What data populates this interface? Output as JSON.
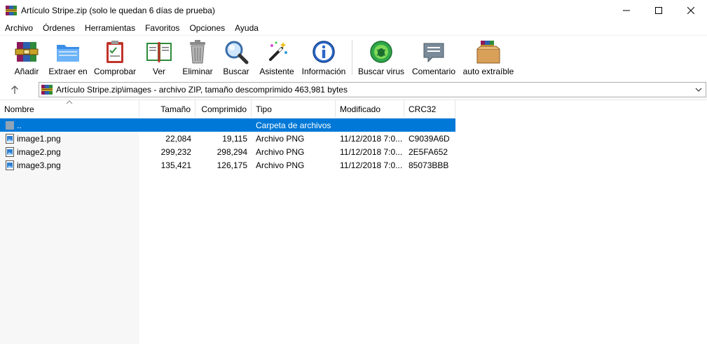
{
  "window": {
    "title": "Artículo Stripe.zip (solo le quedan 6 días de prueba)",
    "icon": "winrar-books-icon"
  },
  "menu": [
    "Archivo",
    "Órdenes",
    "Herramientas",
    "Favoritos",
    "Opciones",
    "Ayuda"
  ],
  "toolbar": [
    {
      "label": "Añadir",
      "icon": "add-archive-icon"
    },
    {
      "label": "Extraer en",
      "icon": "extract-folder-icon"
    },
    {
      "label": "Comprobar",
      "icon": "test-clipboard-icon"
    },
    {
      "label": "Ver",
      "icon": "view-book-icon"
    },
    {
      "label": "Eliminar",
      "icon": "trash-icon"
    },
    {
      "label": "Buscar",
      "icon": "magnifier-icon"
    },
    {
      "label": "Asistente",
      "icon": "wizard-wand-icon"
    },
    {
      "label": "Información",
      "icon": "info-icon"
    },
    {
      "label": "Buscar virus",
      "icon": "virus-scan-icon"
    },
    {
      "label": "Comentario",
      "icon": "comment-icon"
    },
    {
      "label": "auto extraíble",
      "icon": "sfx-box-icon"
    }
  ],
  "address": {
    "path": "Artículo Stripe.zip\\images - archivo ZIP, tamaño descomprimido 463,981 bytes"
  },
  "columns": [
    "Nombre",
    "Tamaño",
    "Comprimido",
    "Tipo",
    "Modificado",
    "CRC32"
  ],
  "rows": [
    {
      "name": "..",
      "size": "",
      "compressed": "",
      "type": "Carpeta de archivos",
      "modified": "",
      "crc": "",
      "selected": true,
      "icon": "parent-folder-icon"
    },
    {
      "name": "image1.png",
      "size": "22,084",
      "compressed": "19,115",
      "type": "Archivo PNG",
      "modified": "11/12/2018 7:0...",
      "crc": "C9039A6D",
      "selected": false,
      "icon": "image-file-icon"
    },
    {
      "name": "image2.png",
      "size": "299,232",
      "compressed": "298,294",
      "type": "Archivo PNG",
      "modified": "11/12/2018 7:0...",
      "crc": "2E5FA652",
      "selected": false,
      "icon": "image-file-icon"
    },
    {
      "name": "image3.png",
      "size": "135,421",
      "compressed": "126,175",
      "type": "Archivo PNG",
      "modified": "11/12/2018 7:0...",
      "crc": "85073BBB",
      "selected": false,
      "icon": "image-file-icon"
    }
  ],
  "colors": {
    "selection": "#0078d7",
    "sort_column_bg": "#f7f7f7"
  }
}
